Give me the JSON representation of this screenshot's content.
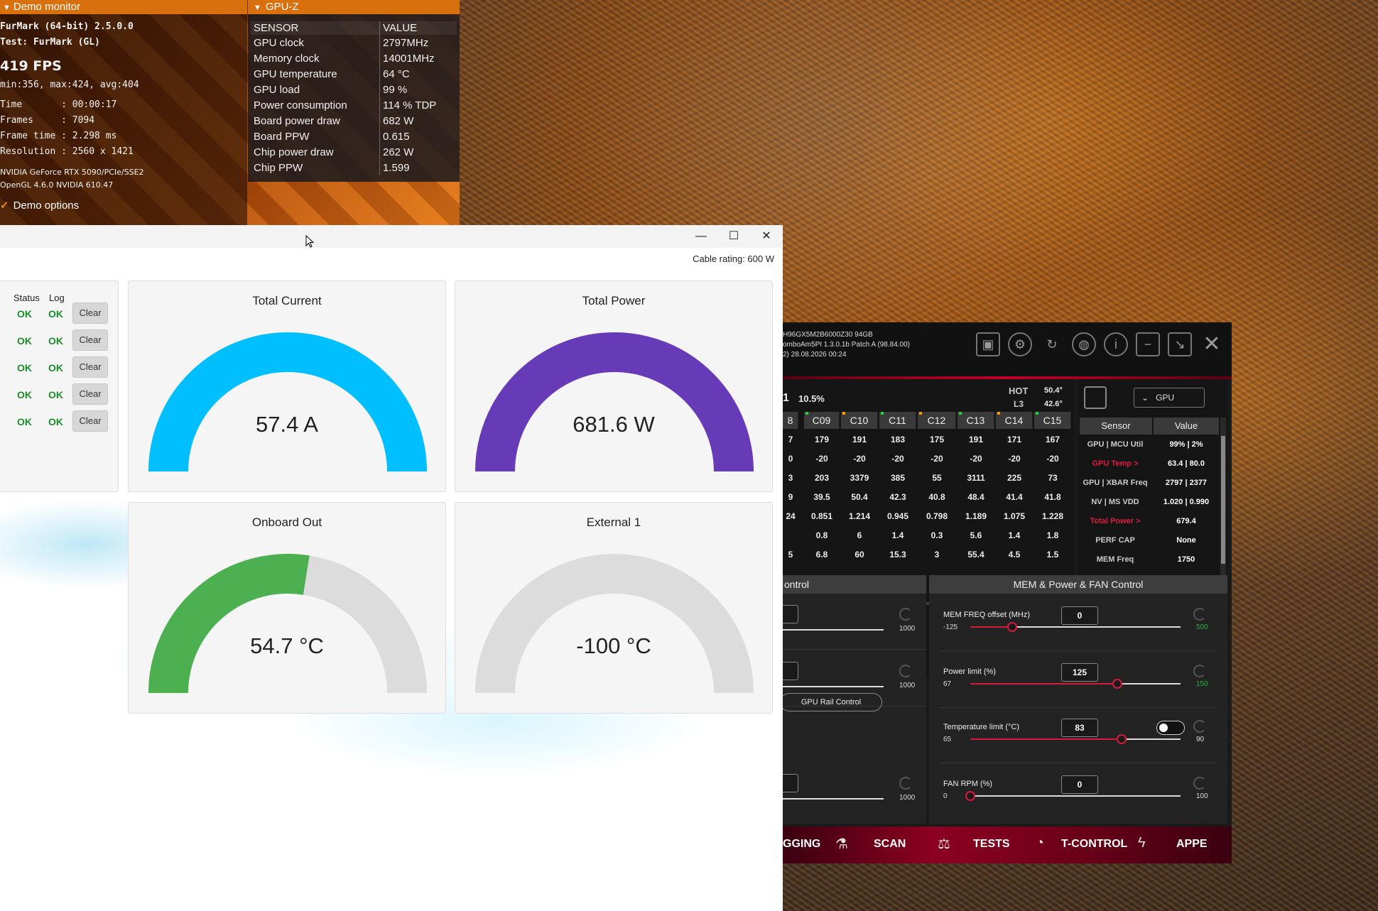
{
  "demo_monitor": {
    "title": "Demo monitor",
    "lines": [
      "FurMark (64-bit) 2.5.0.0",
      "Test: FurMark (GL)"
    ],
    "fps": "419 FPS",
    "fps_stats": "min:356, max:424, avg:404",
    "stats": [
      "Time       : 00:00:17",
      "Frames     : 7094",
      "Frame time : 2.298 ms",
      "Resolution : 2560 x 1421"
    ],
    "gpu_line": "NVIDIA GeForce RTX 5090/PCIe/SSE2",
    "gl_line": "OpenGL 4.6.0 NVIDIA 610.47",
    "options_label": "Demo options"
  },
  "gpuz": {
    "title": "GPU-Z",
    "headers": [
      "SENSOR",
      "VALUE"
    ],
    "rows": [
      [
        "GPU clock",
        "2797MHz"
      ],
      [
        "Memory clock",
        "14001MHz"
      ],
      [
        "GPU temperature",
        "64 °C"
      ],
      [
        "GPU load",
        "99 %"
      ],
      [
        "Power consumption",
        "114 % TDP"
      ],
      [
        "Board power draw",
        "682 W"
      ],
      [
        "Board PPW",
        "0.615"
      ],
      [
        "Chip power draw",
        "262 W"
      ],
      [
        "Chip PPW",
        "1.599"
      ]
    ]
  },
  "gauge_window": {
    "cable_rating": "Cable rating: 600 W",
    "status_headers": {
      "status": "Status",
      "log": "Log"
    },
    "status_rows": [
      {
        "status": "OK",
        "log": "OK",
        "button": "Clear"
      },
      {
        "status": "OK",
        "log": "OK",
        "button": "Clear"
      },
      {
        "status": "OK",
        "log": "OK",
        "button": "Clear"
      },
      {
        "status": "OK",
        "log": "OK",
        "button": "Clear"
      },
      {
        "status": "OK",
        "log": "OK",
        "button": "Clear"
      }
    ],
    "gauges": [
      {
        "title": "Total Current",
        "value": "57.4 A",
        "fraction": 1.0,
        "color": "#00bfff"
      },
      {
        "title": "Total Power",
        "value": "681.6 W",
        "fraction": 1.0,
        "color": "#673ab7"
      },
      {
        "title": "Onboard Out",
        "value": "54.7 °C",
        "fraction": 0.55,
        "color": "#4caf50"
      },
      {
        "title": "External 1",
        "value": "-100 °C",
        "fraction": 0.0,
        "color": "#4caf50"
      }
    ]
  },
  "sensor_app": {
    "info_lines": [
      "H96GX5M2B6000Z30 94GB",
      "omboAm5PI 1.3.0.1b Patch A (98.84.00)",
      "2)    28.08.2026 00:24"
    ],
    "load_index": "1",
    "load_value": "10.5%",
    "hot_label": "HOT",
    "hot_value": "50.4°",
    "l3_label": "L3",
    "l3_value": "42.6°",
    "core_headers": [
      "8",
      "C09",
      "C10",
      "C11",
      "C12",
      "C13",
      "C14",
      "C15"
    ],
    "core_rows": [
      [
        "7",
        "179",
        "191",
        "183",
        "175",
        "191",
        "171",
        "167"
      ],
      [
        "0",
        "-20",
        "-20",
        "-20",
        "-20",
        "-20",
        "-20",
        "-20"
      ],
      [
        "3",
        "203",
        "3379",
        "385",
        "55",
        "3111",
        "225",
        "73"
      ],
      [
        "9",
        "39.5",
        "50.4",
        "42.3",
        "40.8",
        "48.4",
        "41.4",
        "41.8"
      ],
      [
        "24",
        "0.851",
        "1.214",
        "0.945",
        "0.798",
        "1.189",
        "1.075",
        "1.228"
      ],
      [
        "",
        "0.8",
        "6",
        "1.4",
        "0.3",
        "5.6",
        "1.4",
        "1.8"
      ],
      [
        "5",
        "6.8",
        "60",
        "15.3",
        "3",
        "55.4",
        "4.5",
        "1.5"
      ]
    ],
    "gpu_select": "GPU",
    "sensor_headers": [
      "Sensor",
      "Value"
    ],
    "sensor_rows": [
      {
        "label": "GPU | MCU Util",
        "value": "99% | 2%",
        "red": false
      },
      {
        "label": "GPU Temp >",
        "value": "63.4 | 80.0",
        "red": true
      },
      {
        "label": "GPU | XBAR Freq",
        "value": "2797 | 2377",
        "red": false
      },
      {
        "label": "NV | MS VDD",
        "value": "1.020 | 0.990",
        "red": false
      },
      {
        "label": "Total Power >",
        "value": "679.4",
        "red": true
      },
      {
        "label": "PERF CAP",
        "value": "None",
        "red": false
      },
      {
        "label": "MEM Freq",
        "value": "1750",
        "red": false
      }
    ],
    "left_control_title": "ontrol",
    "left_control_max": "1000",
    "rail_button": "GPU Rail Control",
    "right_control_title": "MEM & Power & FAN Control",
    "controls": [
      {
        "label": "MEM FREQ offset (MHz)",
        "value": "0",
        "min": "-125",
        "max": "500",
        "level": 0.2,
        "max_green": true
      },
      {
        "label": "Power limit (%)",
        "value": "125",
        "min": "67",
        "max": "150",
        "level": 0.7,
        "max_green": true
      },
      {
        "label": "Temperature limit (°C)",
        "value": "83",
        "min": "65",
        "max": "90",
        "level": 0.72,
        "max_green": false
      },
      {
        "label": "FAN RPM (%)",
        "value": "0",
        "min": "0",
        "max": "100",
        "level": 0.0,
        "max_green": false
      }
    ],
    "nav": [
      "GGING",
      "SCAN",
      "TESTS",
      "T-CONTROL",
      "APPE"
    ]
  }
}
